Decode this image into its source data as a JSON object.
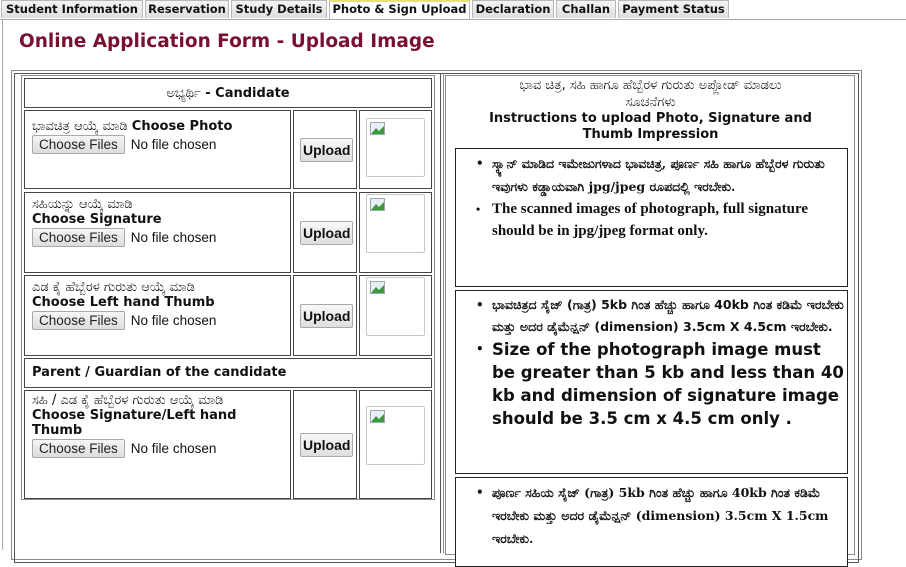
{
  "tabs": [
    {
      "label": "Student Information",
      "active": false
    },
    {
      "label": "Reservation",
      "active": false
    },
    {
      "label": "Study Details",
      "active": false
    },
    {
      "label": "Photo & Sign Upload",
      "active": true
    },
    {
      "label": "Declaration",
      "active": false
    },
    {
      "label": "Challan",
      "active": false
    },
    {
      "label": "Payment Status",
      "active": false
    }
  ],
  "page_title": "Online Application Form - Upload Image",
  "candidate_section": {
    "header_kn": "ಅಭ್ಯರ್ಥಿ",
    "header_en": " - Candidate",
    "rows": [
      {
        "label_kn": "ಭಾವಚಿತ್ರ ಆಯ್ಕೆ ಮಾಡಿ ",
        "label_en": "Choose Photo",
        "choose_button": "Choose Files",
        "file_status": "No file chosen",
        "upload_button": "Upload"
      },
      {
        "label_kn": "ಸಹಿಯನ್ನು ಆಯ್ಕೆ ಮಾಡಿ",
        "label_en": "Choose Signature",
        "choose_button": "Choose Files",
        "file_status": "No file chosen",
        "upload_button": "Upload"
      },
      {
        "label_kn": "ಎಡ ಕೈ ಹೆಬ್ಬೆರಳ ಗುರುತು ಆಯ್ಕೆ ಮಾಡಿ",
        "label_en": "Choose Left hand Thumb",
        "choose_button": "Choose Files",
        "file_status": "No file chosen",
        "upload_button": "Upload"
      }
    ]
  },
  "guardian_section": {
    "header": "Parent / Guardian of the candidate",
    "rows": [
      {
        "label_kn": "ಸಹಿ / ಎಡ ಕೈ ಹೆಬ್ಬೆರಳ ಗುರುತು ಆಯ್ಕೆ    ಮಾಡಿ",
        "label_en": "Choose Signature/Left hand Thumb",
        "choose_button": "Choose Files",
        "file_status": "No file chosen",
        "upload_button": "Upload"
      }
    ]
  },
  "instructions": {
    "title_kn": "ಭಾವ ಚಿತ್ರ, ಸಹಿ ಹಾಗೂ ಹೆಬ್ಬೆರಳ ಗುರುತು ಅಪ್ಲೋಡ್ ಮಾಡಲು ಸೂಚನೆಗಳು",
    "title_en": "Instructions to upload Photo, Signature and Thumb Impression",
    "boxes": [
      {
        "kn": "ಸ್ಕ್ಯಾನ್ ಮಾಡಿದ ಇಮೇಜುಗಳಾದ ಭಾವಚಿತ್ರ, ಪೂರ್ಣ ಸಹಿ ಹಾಗೂ ಹೆಬ್ಬೆರಳ ಗುರುತು ಇವುಗಳು ಕಡ್ಡಾಯವಾಗಿ jpg/jpeg ರೂಪದಲ್ಲಿ ಇರಬೇಕು.",
        "en": "The scanned images of photograph, full signature should be in jpg/jpeg format only."
      },
      {
        "kn": "ಭಾವಚಿತ್ರದ ಸೈಜ್ (ಗಾತ್ರ) 5kb ಗಿಂತ ಹೆಚ್ಚು ಹಾಗೂ 40kb ಗಿಂತ ಕಡಿಮೆ ಇರಬೇಕು ಮತ್ತು ಅದರ ಡೈಮೆನ್ಷನ್ (dimension) 3.5cm X 4.5cm ಇರಬೇಕು.",
        "en": "Size of the photograph image must be greater than 5 kb and less than 40 kb and dimension of signature image should be 3.5 cm x 4.5 cm only ."
      },
      {
        "kn": "ಪೂರ್ಣ ಸಹಿಯ ಸೈಜ್ (ಗಾತ್ರ) 5kb ಗಿಂತ ಹೆಚ್ಚು ಹಾಗೂ 40kb ಗಿಂತ ಕಡಿಮೆ ಇರಬೇಕು ಮತ್ತು ಅದರ ಡೈಮೆನ್ಷನ್ (dimension) 3.5cm X 1.5cm ಇರಬೇಕು."
      }
    ]
  },
  "colors": {
    "title": "#7a1030",
    "active_tab_accent": "#e8e07a"
  }
}
